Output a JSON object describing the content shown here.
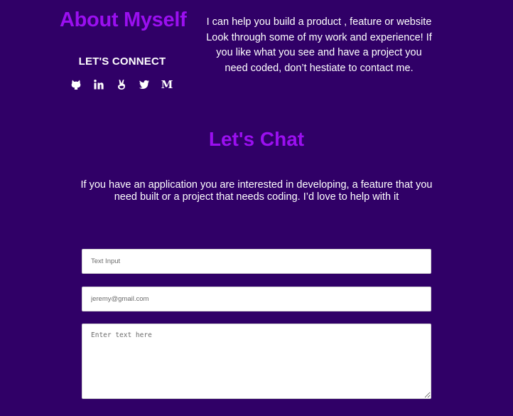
{
  "about": {
    "title": "About Myself",
    "connect_heading": "LET'S CONNECT",
    "description": "I can help you build a product , feature or website Look through some of my work and experience! If you like what you see and have a project you need coded, don’t hestiate to contact me.",
    "social_icons": [
      "github-icon",
      "linkedin-icon",
      "angellist-icon",
      "twitter-icon",
      "medium-icon"
    ],
    "medium_glyph": "M"
  },
  "chat": {
    "title": "Let's Chat",
    "description": "If you have an application you are interested in developing, a feature that you need built or a project that needs coding. I’d love to help with it"
  },
  "form": {
    "text_input_placeholder": "Text Input",
    "email_placeholder": "jeremy@gmail.com",
    "message_placeholder": "Enter text here"
  },
  "colors": {
    "background": "#300067",
    "accent": "#9b0ff0",
    "text": "#ffffff"
  }
}
